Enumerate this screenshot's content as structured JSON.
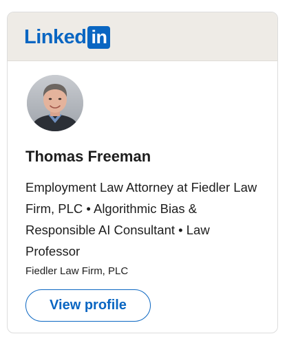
{
  "brand": {
    "logo_text": "Linked",
    "logo_box_text": "in",
    "color": "#0a66c2"
  },
  "profile": {
    "name": "Thomas Freeman",
    "headline": "Employment Law Attorney at Fiedler Law Firm, PLC • Algorithmic Bias & Responsible AI Consultant • Law Professor",
    "company": "Fiedler Law Firm, PLC",
    "avatar_icon": "person-photo"
  },
  "actions": {
    "view_profile_label": "View profile"
  },
  "colors": {
    "header_bg": "#eeebe6",
    "text": "#1d1d1d",
    "accent": "#0a66c2"
  }
}
